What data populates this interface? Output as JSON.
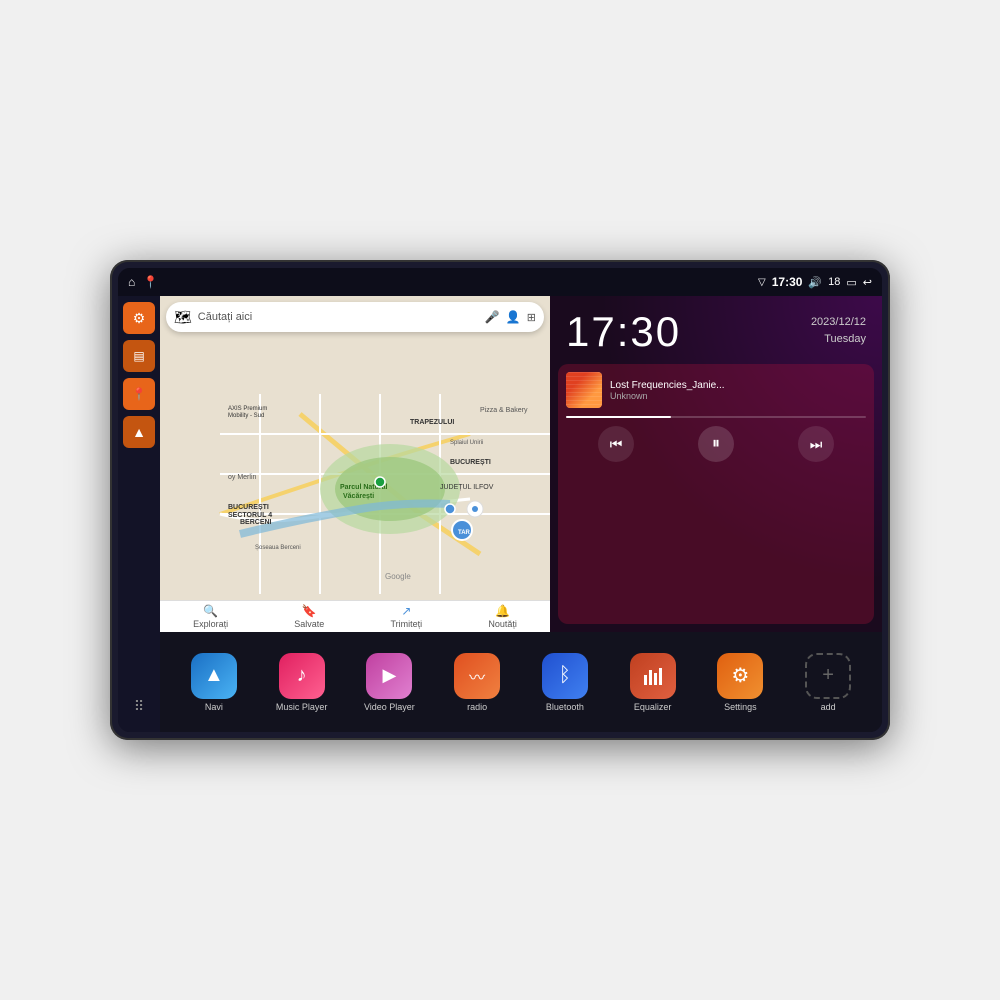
{
  "device": {
    "status_bar": {
      "left_icons": [
        "home",
        "map-marker"
      ],
      "time": "17:30",
      "signal": "▼",
      "volume": "🔊",
      "battery_level": "18",
      "battery_icon": "▭",
      "back_icon": "↩"
    },
    "sidebar": {
      "buttons": [
        {
          "id": "settings",
          "icon": "⚙",
          "color": "orange",
          "label": "Settings"
        },
        {
          "id": "files",
          "icon": "▤",
          "color": "dark-orange",
          "label": "Files"
        },
        {
          "id": "maps",
          "icon": "📍",
          "color": "orange",
          "label": "Maps"
        },
        {
          "id": "navigation",
          "icon": "▲",
          "color": "dark-orange",
          "label": "Navigation"
        },
        {
          "id": "grid",
          "icon": "⋮⋮⋮",
          "color": "grid",
          "label": "Apps"
        }
      ]
    },
    "map": {
      "search_placeholder": "Căutați aici",
      "bottom_nav": [
        {
          "icon": "🔍",
          "label": "Explorați"
        },
        {
          "icon": "🔖",
          "label": "Salvate"
        },
        {
          "icon": "↗",
          "label": "Trimiteți"
        },
        {
          "icon": "🔔",
          "label": "Noutăți"
        }
      ],
      "locations": [
        "AXIS Premium Mobility - Sud",
        "Pizza & Bakery",
        "Parcul Natural Văcărești",
        "BUCUREȘTI SECTORUL 4",
        "BUCUREȘTI",
        "JUDEȚUL ILFOV",
        "BERCENI",
        "oy Merlin"
      ]
    },
    "clock": {
      "time": "17:30",
      "date_line1": "2023/12/12",
      "date_line2": "Tuesday"
    },
    "music": {
      "track_name": "Lost Frequencies_Janie...",
      "artist": "Unknown",
      "progress": 35,
      "controls": {
        "prev": "⏮",
        "play": "⏸",
        "next": "⏭"
      }
    },
    "apps": [
      {
        "id": "navi",
        "label": "Navi",
        "icon_class": "icon-navi",
        "icon": "▲"
      },
      {
        "id": "music-player",
        "label": "Music Player",
        "icon_class": "icon-music",
        "icon": "♪"
      },
      {
        "id": "video-player",
        "label": "Video Player",
        "icon_class": "icon-video",
        "icon": "▶"
      },
      {
        "id": "radio",
        "label": "radio",
        "icon_class": "icon-radio",
        "icon": "〰"
      },
      {
        "id": "bluetooth",
        "label": "Bluetooth",
        "icon_class": "icon-bt",
        "icon": "ᛒ"
      },
      {
        "id": "equalizer",
        "label": "Equalizer",
        "icon_class": "icon-eq",
        "icon": "≡"
      },
      {
        "id": "settings",
        "label": "Settings",
        "icon_class": "icon-settings",
        "icon": "⚙"
      },
      {
        "id": "add",
        "label": "add",
        "icon_class": "icon-add",
        "icon": "+"
      }
    ]
  }
}
